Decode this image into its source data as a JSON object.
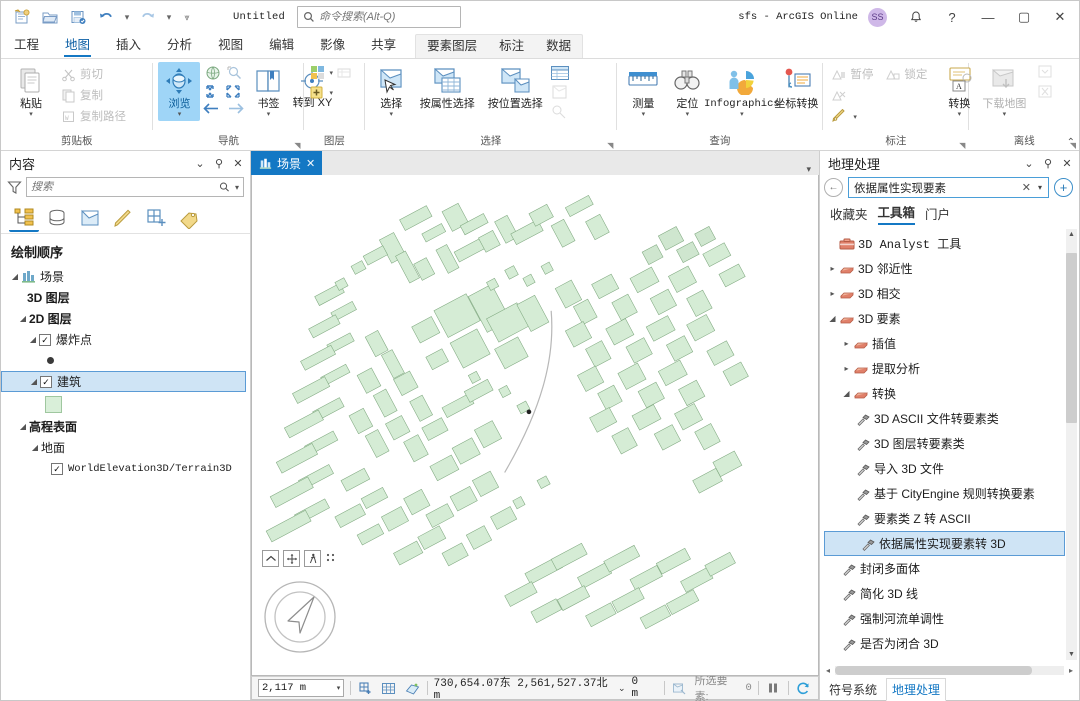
{
  "titlebar": {
    "document_title": "Untitled",
    "search_placeholder": "命令搜索(Alt-Q)",
    "account_text": "sfs - ArcGIS Online",
    "avatar_initials": "SS",
    "quick_access": [
      "new-project-icon",
      "open-project-icon",
      "save-project-icon",
      "undo-icon",
      "redo-icon",
      "customize-qat-icon"
    ],
    "window_buttons": {
      "minimize": "—",
      "maximize": "▢",
      "close": "✕"
    },
    "notification_icon": "bell-icon",
    "help_icon": "?"
  },
  "ribbon_tabs": {
    "main": [
      "工程",
      "地图",
      "插入",
      "分析",
      "视图",
      "编辑",
      "影像",
      "共享"
    ],
    "active": "地图",
    "contextual_label": "要素图层",
    "contextual": [
      "要素图层",
      "标注",
      "数据"
    ]
  },
  "ribbon": {
    "groups": [
      {
        "label": "剪贴板",
        "big": [
          {
            "name": "粘贴",
            "caret": true
          }
        ],
        "small": [
          {
            "name": "剪切",
            "disabled": true
          },
          {
            "name": "复制",
            "disabled": true
          },
          {
            "name": "复制路径",
            "disabled": true
          }
        ]
      },
      {
        "label": "导航",
        "big": [
          {
            "name": "浏览",
            "caret": true,
            "selected": true
          },
          {
            "name": "书签",
            "caret": true
          },
          {
            "name": "转到 XY",
            "caret": false
          }
        ],
        "dialog_launcher": true
      },
      {
        "label": "图层",
        "big": [],
        "small": []
      },
      {
        "label": "选择",
        "big": [
          {
            "name": "选择",
            "caret": true
          },
          {
            "name": "按属性选择",
            "caret": false
          },
          {
            "name": "按位置选择",
            "caret": false
          }
        ],
        "dialog_launcher": true
      },
      {
        "label": "查询",
        "big": [
          {
            "name": "测量",
            "caret": true
          },
          {
            "name": "定位",
            "caret": true
          },
          {
            "name": "Infographics",
            "caret": true
          },
          {
            "name": "坐标转换",
            "caret": false
          }
        ]
      },
      {
        "label": "标注",
        "big": [
          {
            "name": "转换",
            "caret": true
          }
        ],
        "small": [
          {
            "name": "暂停",
            "disabled": true
          },
          {
            "name": "锁定",
            "disabled": true
          }
        ],
        "dialog_launcher": true
      },
      {
        "label": "离线",
        "big": [
          {
            "name": "下载地图",
            "caret": true,
            "disabled": true
          }
        ],
        "dialog_launcher": true
      }
    ]
  },
  "contents_pane": {
    "title": "内容",
    "filter_placeholder": "搜索",
    "tabs": [
      "list-by-drawing-order-icon",
      "list-by-data-source-icon",
      "list-by-selection-icon",
      "list-by-editing-icon",
      "list-by-snapping-icon",
      "list-by-labeling-icon"
    ],
    "active_tab_index": 0,
    "heading": "绘制顺序",
    "tree": [
      {
        "label": "场景",
        "level": 0,
        "type": "scene",
        "expanded": true,
        "bold": true
      },
      {
        "label": "3D 图层",
        "level": 1,
        "type": "group",
        "bold": true
      },
      {
        "label": "2D 图层",
        "level": 1,
        "type": "group",
        "expanded": true,
        "bold": true
      },
      {
        "label": "爆炸点",
        "level": 2,
        "type": "layer",
        "checked": true,
        "expanded": true
      },
      {
        "label": "",
        "level": 3,
        "type": "symbol-point"
      },
      {
        "label": "建筑",
        "level": 2,
        "type": "layer",
        "checked": true,
        "expanded": true,
        "selected": true
      },
      {
        "label": "",
        "level": 3,
        "type": "symbol-polygon"
      },
      {
        "label": "高程表面",
        "level": 1,
        "type": "group",
        "expanded": true,
        "bold": true
      },
      {
        "label": "地面",
        "level": 2,
        "type": "group",
        "expanded": true
      },
      {
        "label": "WorldElevation3D/Terrain3D",
        "level": 3,
        "type": "layer",
        "checked": true,
        "mono": true
      }
    ]
  },
  "view": {
    "tab_label": "场景",
    "tab_icon": "scene-icon",
    "close_icon": "✕",
    "nav_buttons": [
      "full-extent-icon",
      "pan-icon",
      "walk-mode-icon"
    ],
    "compass": "compass-navigator"
  },
  "statusbar": {
    "scale_value": "2,117 m",
    "buttons": [
      "add-data-icon",
      "grid-icon",
      "3d-mode-icon"
    ],
    "coordinates": "730,654.07东  2,561,527.37北  m",
    "coord_caret": "⌄",
    "elevation": "0 m",
    "selection_icon": "selection-icon",
    "selection_label": "所选要素:",
    "selection_count": "0",
    "pause_icon": "pause-drawing-icon",
    "refresh_icon": "refresh-icon"
  },
  "geoprocessing_pane": {
    "title": "地理处理",
    "back_icon": "back-arrow-icon",
    "search_value": "依据属性实现要素",
    "clear_icon": "✕",
    "dropdown_icon": "⌄",
    "add_icon": "+",
    "tabs": [
      "收藏夹",
      "工具箱",
      "门户"
    ],
    "active_tab": "工具箱",
    "tree": [
      {
        "label": "3D Analyst 工具",
        "level": 0,
        "type": "toolbox",
        "arrow": "none",
        "mono_prefix": true
      },
      {
        "label": "3D 邻近性",
        "level": 1,
        "type": "toolset",
        "arrow": "collapsed"
      },
      {
        "label": "3D 相交",
        "level": 1,
        "type": "toolset",
        "arrow": "collapsed"
      },
      {
        "label": "3D 要素",
        "level": 1,
        "type": "toolset",
        "arrow": "expanded"
      },
      {
        "label": "插值",
        "level": 2,
        "type": "toolset",
        "arrow": "collapsed"
      },
      {
        "label": "提取分析",
        "level": 2,
        "type": "toolset",
        "arrow": "collapsed"
      },
      {
        "label": "转换",
        "level": 2,
        "type": "toolset",
        "arrow": "expanded"
      },
      {
        "label": "3D ASCII 文件转要素类",
        "level": 3,
        "type": "tool"
      },
      {
        "label": "3D 图层转要素类",
        "level": 3,
        "type": "tool"
      },
      {
        "label": "导入 3D 文件",
        "level": 3,
        "type": "tool"
      },
      {
        "label": "基于 CityEngine 规则转换要素",
        "level": 3,
        "type": "tool"
      },
      {
        "label": "要素类 Z 转 ASCII",
        "level": 3,
        "type": "tool"
      },
      {
        "label": "依据属性实现要素转 3D",
        "level": 3,
        "type": "tool",
        "selected": true
      },
      {
        "label": "封闭多面体",
        "level": 2,
        "type": "tool"
      },
      {
        "label": "简化 3D 线",
        "level": 2,
        "type": "tool"
      },
      {
        "label": "强制河流单调性",
        "level": 2,
        "type": "tool"
      },
      {
        "label": "是否为闭合 3D",
        "level": 2,
        "type": "tool"
      }
    ],
    "footer_tabs": [
      "符号系统",
      "地理处理"
    ],
    "footer_active": "地理处理"
  },
  "colors": {
    "accent": "#1478c4",
    "selection": "#cfe4f5",
    "ribbon_selected": "#9fd5f7",
    "building_fill": "#d5ecd5",
    "building_stroke": "#7fa87f",
    "avatar_bg": "#cfb8e8"
  }
}
